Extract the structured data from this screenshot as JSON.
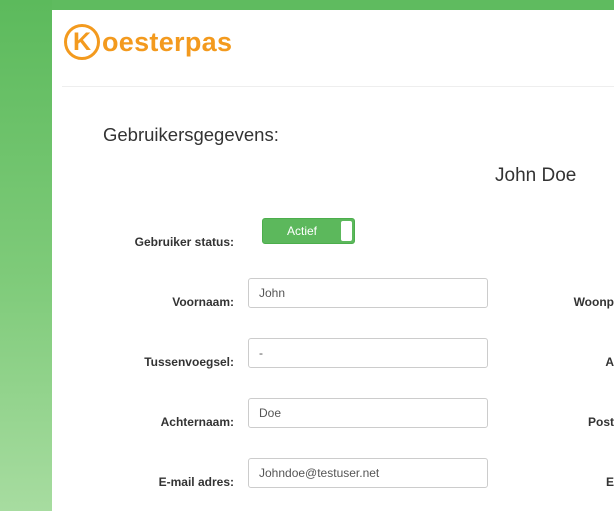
{
  "brand": {
    "logo_letter": "K",
    "logo_rest": "oesterpas"
  },
  "page": {
    "section_title": "Gebruikersgegevens:",
    "user_name": "John Doe"
  },
  "status": {
    "label": "Gebruiker status:",
    "toggle_text": "Actief"
  },
  "form": {
    "first_name": {
      "label": "Voornaam:",
      "value": "John"
    },
    "infix": {
      "label": "Tussenvoegsel:",
      "value": "-"
    },
    "last_name": {
      "label": "Achternaam:",
      "value": "Doe"
    },
    "email": {
      "label": "E-mail adres:",
      "value": "Johndoe@testuser.net"
    }
  },
  "right_labels": {
    "city": "Woonp",
    "address": "A",
    "postcode": "Post",
    "other": "E"
  },
  "colors": {
    "brand_orange": "#f39a1e",
    "accent_green": "#5cb85c"
  }
}
